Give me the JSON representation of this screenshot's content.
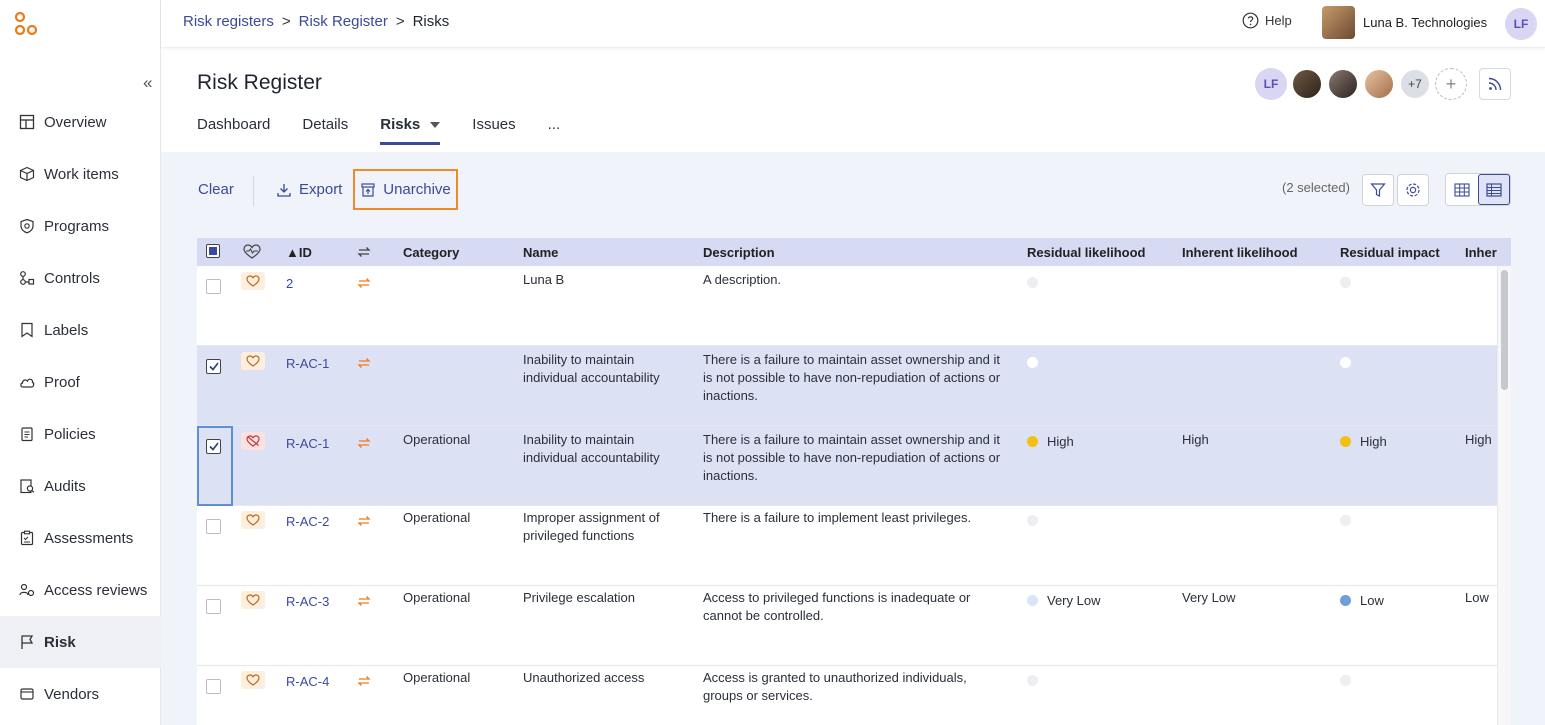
{
  "breadcrumb": {
    "item1": "Risk registers",
    "sep1": ">",
    "item2": "Risk Register",
    "sep2": ">",
    "current": "Risks"
  },
  "topbar": {
    "help": "Help",
    "org_name": "Luna B. Technologies",
    "user_initials": "LF"
  },
  "sidebar": {
    "collapse": "«",
    "items": [
      {
        "label": "Overview",
        "icon": "layout-icon"
      },
      {
        "label": "Work items",
        "icon": "box-icon"
      },
      {
        "label": "Programs",
        "icon": "shield-icon"
      },
      {
        "label": "Controls",
        "icon": "controls-icon"
      },
      {
        "label": "Labels",
        "icon": "label-icon"
      },
      {
        "label": "Proof",
        "icon": "cloud-icon"
      },
      {
        "label": "Policies",
        "icon": "policy-icon"
      },
      {
        "label": "Audits",
        "icon": "audit-icon"
      },
      {
        "label": "Assessments",
        "icon": "clipboard-icon"
      },
      {
        "label": "Access reviews",
        "icon": "access-icon"
      },
      {
        "label": "Risk",
        "icon": "flag-icon"
      },
      {
        "label": "Vendors",
        "icon": "vendor-icon"
      }
    ]
  },
  "header": {
    "title": "Risk Register",
    "member_initials": "LF",
    "more_members": "+7",
    "add_member": "+",
    "tabs": [
      "Dashboard",
      "Details",
      "Risks",
      "Issues",
      "..."
    ]
  },
  "toolbar": {
    "clear": "Clear",
    "export": "Export",
    "unarchive": "Unarchive",
    "selected": "(2 selected)"
  },
  "colors": {
    "accent": "#3a4a9c",
    "highlight": "#ef8a2a",
    "high": "#f2c012",
    "very_low": "#d6e6f7",
    "low": "#6e9fd6"
  },
  "table": {
    "columns": {
      "id": "▲ID",
      "category": "Category",
      "name": "Name",
      "description": "Description",
      "residual_likelihood": "Residual likelihood",
      "inherent_likelihood": "Inherent likelihood",
      "residual_impact": "Residual impact",
      "inherent_impact": "Inher"
    },
    "rows": [
      {
        "id": "2",
        "category": "",
        "name": "Luna B",
        "description": "A description.",
        "rl": "",
        "il": "",
        "ri": "",
        "ii": "",
        "selected": false
      },
      {
        "id": "R-AC-1",
        "category": "",
        "name": "Inability to maintain individual accountability",
        "description": "There is a failure to maintain asset ownership and it is not possible to have non-repudiation of actions or inactions.",
        "rl": "",
        "il": "",
        "ri": "",
        "ii": "",
        "selected": true
      },
      {
        "id": "R-AC-1",
        "category": "Operational",
        "name": "Inability to maintain individual accountability",
        "description": "There is a failure to maintain asset ownership and it is not possible to have non-repudiation of actions or inactions.",
        "rl": "High",
        "il": "High",
        "ri": "High",
        "ii": "High",
        "selected": true
      },
      {
        "id": "R-AC-2",
        "category": "Operational",
        "name": "Improper assignment of privileged functions",
        "description": "There is a failure to implement least privileges.",
        "rl": "",
        "il": "",
        "ri": "",
        "ii": "",
        "selected": false
      },
      {
        "id": "R-AC-3",
        "category": "Operational",
        "name": "Privilege escalation",
        "description": "Access to privileged functions is inadequate or cannot be controlled.",
        "rl": "Very Low",
        "il": "Very Low",
        "ri": "Low",
        "ii": "Low",
        "selected": false
      },
      {
        "id": "R-AC-4",
        "category": "Operational",
        "name": "Unauthorized access",
        "description": "Access is granted to unauthorized individuals, groups or services.",
        "rl": "",
        "il": "",
        "ri": "",
        "ii": "",
        "selected": false
      }
    ]
  }
}
